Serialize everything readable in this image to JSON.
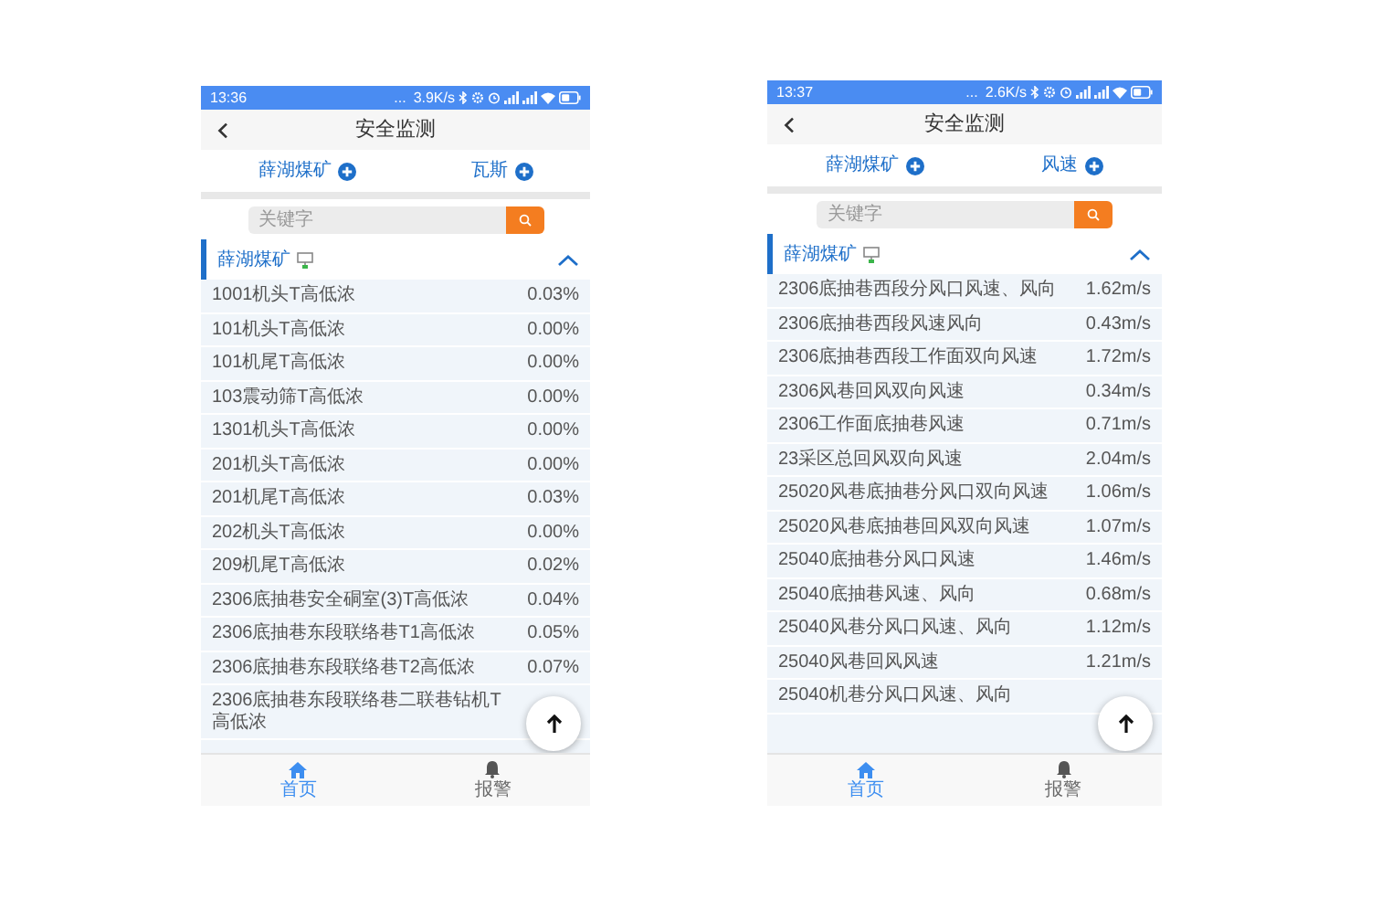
{
  "phones": [
    {
      "status_bar": {
        "time": "13:36",
        "dots": "...",
        "speed": "3.9K/s"
      },
      "title": "安全监测",
      "filters": [
        {
          "label": "薛湖煤矿"
        },
        {
          "label": "瓦斯"
        }
      ],
      "search": {
        "placeholder": "关键字"
      },
      "group": {
        "label": "薛湖煤矿",
        "expanded": true
      },
      "rows": [
        {
          "name": "1001机头T高低浓",
          "value": "0.03%"
        },
        {
          "name": "101机头T高低浓",
          "value": "0.00%"
        },
        {
          "name": "101机尾T高低浓",
          "value": "0.00%"
        },
        {
          "name": "103震动筛T高低浓",
          "value": "0.00%"
        },
        {
          "name": "1301机头T高低浓",
          "value": "0.00%"
        },
        {
          "name": "201机头T高低浓",
          "value": "0.00%"
        },
        {
          "name": "201机尾T高低浓",
          "value": "0.03%"
        },
        {
          "name": "202机头T高低浓",
          "value": "0.00%"
        },
        {
          "name": "209机尾T高低浓",
          "value": "0.02%"
        },
        {
          "name": "2306底抽巷安全硐室(3)T高低浓",
          "value": "0.04%"
        },
        {
          "name": "2306底抽巷东段联络巷T1高低浓",
          "value": "0.05%"
        },
        {
          "name": "2306底抽巷东段联络巷T2高低浓",
          "value": "0.07%"
        },
        {
          "name": "2306底抽巷东段联络巷二联巷钻机T高低浓"
        }
      ],
      "nav": [
        {
          "kind": "home",
          "label": "首页",
          "selected": true
        },
        {
          "kind": "bell",
          "label": "报警",
          "selected": false
        }
      ]
    },
    {
      "status_bar": {
        "time": "13:37",
        "dots": "...",
        "speed": "2.6K/s"
      },
      "title": "安全监测",
      "filters": [
        {
          "label": "薛湖煤矿"
        },
        {
          "label": "风速"
        }
      ],
      "search": {
        "placeholder": "关键字"
      },
      "group": {
        "label": "薛湖煤矿",
        "expanded": true
      },
      "rows": [
        {
          "name": "2306底抽巷西段分风口风速、风向",
          "value": "1.62m/s"
        },
        {
          "name": "2306底抽巷西段风速风向",
          "value": "0.43m/s"
        },
        {
          "name": "2306底抽巷西段工作面双向风速",
          "value": "1.72m/s"
        },
        {
          "name": "2306风巷回风双向风速",
          "value": "0.34m/s"
        },
        {
          "name": "2306工作面底抽巷风速",
          "value": "0.71m/s"
        },
        {
          "name": "23采区总回风双向风速",
          "value": "2.04m/s"
        },
        {
          "name": "25020风巷底抽巷分风口双向风速",
          "value": "1.06m/s"
        },
        {
          "name": "25020风巷底抽巷回风双向风速",
          "value": "1.07m/s"
        },
        {
          "name": "25040底抽巷分风口风速",
          "value": "1.46m/s"
        },
        {
          "name": "25040底抽巷风速、风向",
          "value": "0.68m/s"
        },
        {
          "name": "25040风巷分风口风速、风向",
          "value": "1.12m/s"
        },
        {
          "name": "25040风巷回风风速",
          "value": "1.21m/s"
        },
        {
          "name": "25040机巷分风口风速、风向"
        }
      ],
      "nav": [
        {
          "kind": "home",
          "label": "首页",
          "selected": true
        },
        {
          "kind": "bell",
          "label": "报警",
          "selected": false
        }
      ]
    }
  ]
}
